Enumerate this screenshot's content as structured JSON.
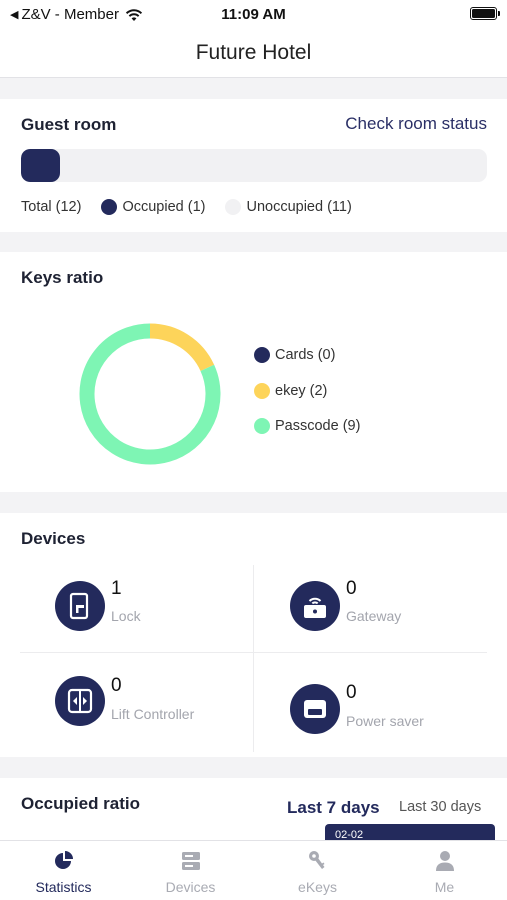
{
  "status_bar": {
    "carrier": "Z&V - Member",
    "time": "11:09 AM"
  },
  "nav": {
    "title": "Future Hotel"
  },
  "guest_room": {
    "title": "Guest room",
    "link": "Check room status",
    "occupied_fraction": 0.083,
    "total_label": "Total (12)",
    "occupied_label": "Occupied (1)",
    "unoccupied_label": "Unoccupied (11)",
    "occupied_color": "#232a5c",
    "unoccupied_color": "#f1f1f3"
  },
  "keys_ratio": {
    "title": "Keys ratio",
    "legend": [
      {
        "label": "Cards (0)",
        "value": 0,
        "color": "#232a5c"
      },
      {
        "label": "ekey (2)",
        "value": 2,
        "color": "#fdd45a"
      },
      {
        "label": "Passcode (9)",
        "value": 9,
        "color": "#7ef5b4"
      }
    ]
  },
  "devices": {
    "title": "Devices",
    "items": [
      {
        "count": "1",
        "label": "Lock",
        "icon": "lock-icon"
      },
      {
        "count": "0",
        "label": "Gateway",
        "icon": "gateway-icon"
      },
      {
        "count": "0",
        "label": "Lift Controller",
        "icon": "lift-controller-icon"
      },
      {
        "count": "0",
        "label": "Power saver",
        "icon": "power-saver-icon"
      }
    ]
  },
  "occupied_ratio": {
    "title": "Occupied ratio",
    "tab_7": "Last 7 days",
    "tab_30": "Last 30 days",
    "tooltip": "02-02"
  },
  "tab_bar": {
    "tabs": [
      {
        "label": "Statistics",
        "icon": "statistics-icon",
        "active": true
      },
      {
        "label": "Devices",
        "icon": "devices-icon",
        "active": false
      },
      {
        "label": "eKeys",
        "icon": "ekeys-icon",
        "active": false
      },
      {
        "label": "Me",
        "icon": "me-icon",
        "active": false
      }
    ]
  },
  "colors": {
    "primary": "#232a5c",
    "inactive": "#a9abb3"
  }
}
